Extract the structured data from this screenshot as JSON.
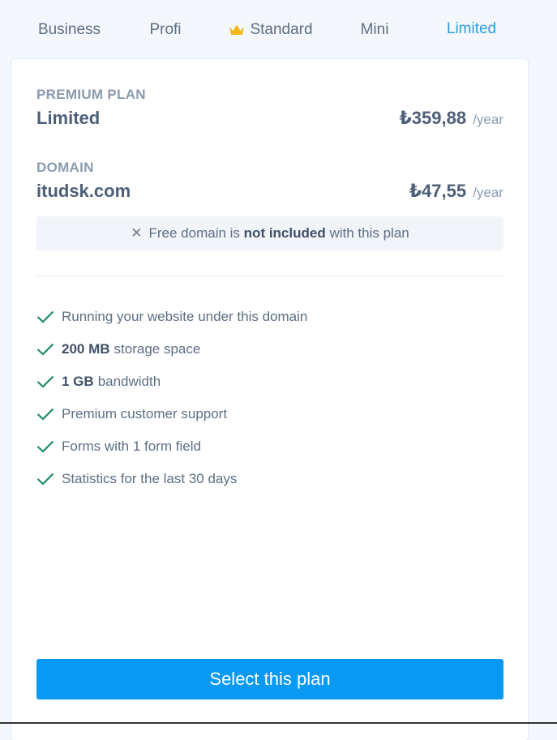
{
  "tabs": [
    {
      "label": "Business",
      "active": false
    },
    {
      "label": "Profi",
      "active": false
    },
    {
      "label": "Standard",
      "active": false,
      "icon": "crown-icon",
      "icon_color": "#f3b81b"
    },
    {
      "label": "Mini",
      "active": false
    },
    {
      "label": "Limited",
      "active": true
    }
  ],
  "plan": {
    "caption": "PREMIUM PLAN",
    "name": "Limited",
    "price": "₺359,88",
    "period": "/year"
  },
  "domain": {
    "caption": "DOMAIN",
    "name": "itudsk.com",
    "price": "₺47,55",
    "period": "/year"
  },
  "notice": {
    "icon": "close-icon",
    "prefix": "Free domain is",
    "emphasis": "not included",
    "suffix": "with this plan"
  },
  "features": [
    {
      "bold": "",
      "text": "Running your website under this domain"
    },
    {
      "bold": "200 MB",
      "text": "storage space"
    },
    {
      "bold": "1 GB",
      "text": "bandwidth"
    },
    {
      "bold": "",
      "text": "Premium customer support"
    },
    {
      "bold": "",
      "text": "Forms with 1 form field"
    },
    {
      "bold": "",
      "text": "Statistics for the last 30 days"
    }
  ],
  "cta": {
    "label": "Select this plan"
  },
  "colors": {
    "accent": "#2a9fd8",
    "button": "#0a99f2",
    "check": "#1d8a6a",
    "crown": "#f3b81b"
  }
}
